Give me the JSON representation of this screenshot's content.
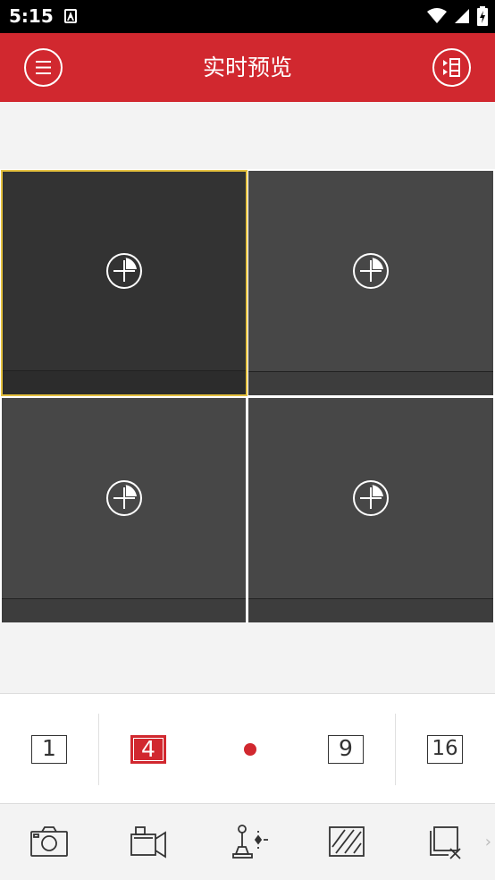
{
  "status_bar": {
    "time": "5:15"
  },
  "header": {
    "title": "实时预览",
    "menu_icon": "menu-icon",
    "device_list_icon": "device-list-icon"
  },
  "colors": {
    "brand": "#d1282f",
    "active_border": "#e5c13f",
    "cell": "#474747"
  },
  "layout_options": [
    "1",
    "4",
    "9",
    "16"
  ],
  "selected_layout": "4",
  "toolbar": [
    "camera-icon",
    "record-icon",
    "ptz-icon",
    "quality-icon",
    "close-window-icon"
  ],
  "more": "›"
}
